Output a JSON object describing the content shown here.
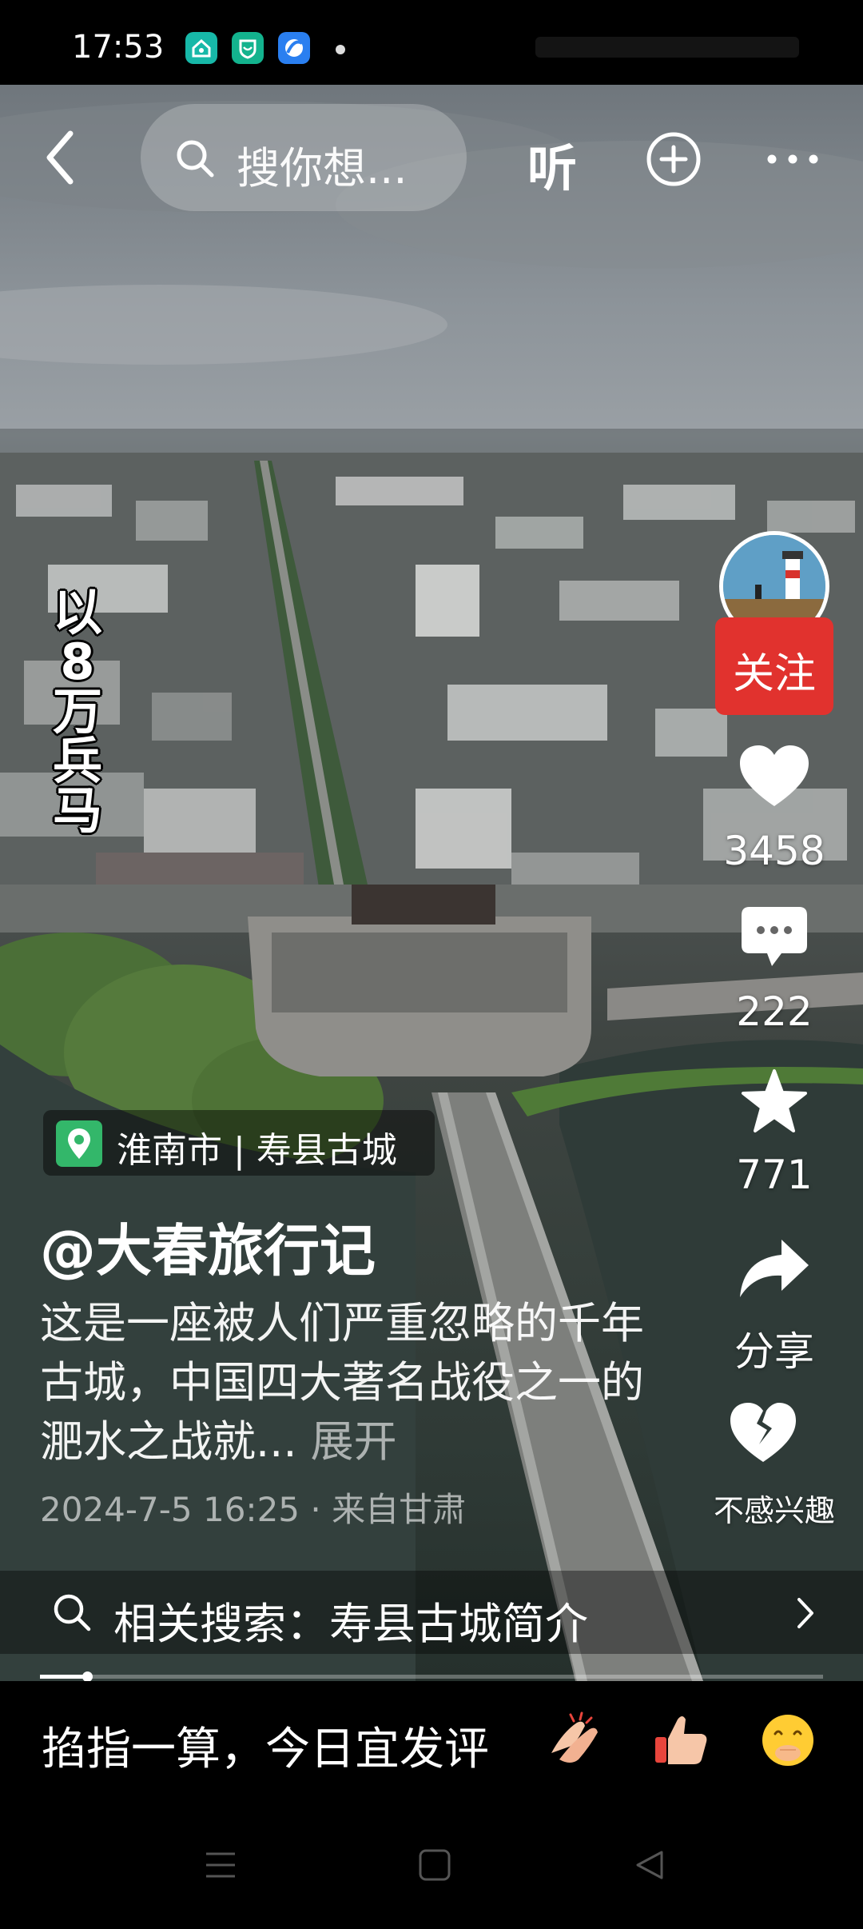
{
  "status_bar": {
    "time": "17:53",
    "app_icons": [
      "home-app-icon",
      "shield-app-icon",
      "blue-app-icon"
    ],
    "app_colors": [
      "#17b8a8",
      "#13b38e",
      "#2a7ff0"
    ]
  },
  "top_bar": {
    "search_placeholder": "搜你想...",
    "listen_label": "听",
    "icons": [
      "back-icon",
      "search-icon",
      "add-circle-icon",
      "more-icon"
    ]
  },
  "video": {
    "caption_vertical": "以8万兵马"
  },
  "right_rail": {
    "follow_label": "关注",
    "like_count": "3458",
    "comment_count": "222",
    "favorite_count": "771",
    "share_label": "分享",
    "not_interested_label": "不感兴趣",
    "follow_color": "#e1322e"
  },
  "post": {
    "location": "淮南市 | 寿县古城",
    "author": "@大春旅行记",
    "description": "这是一座被人们严重忽略的千年古城，中国四大著名战役之一的淝水之战就...",
    "expand_label": "展开",
    "meta": "2024-7-5 16:25 · 来自甘肃"
  },
  "related_search": {
    "text": "相关搜索：寿县古城简介"
  },
  "playback": {
    "progress": 0.06
  },
  "comment_bar": {
    "prompt": "掐指一算，今日宜发评",
    "emojis": [
      "clapping-hands-emoji",
      "thumbs-up-emoji",
      "giggle-face-emoji"
    ]
  },
  "nav_bar": {
    "icons": [
      "menu-nav-icon",
      "home-nav-icon",
      "back-nav-icon"
    ]
  }
}
